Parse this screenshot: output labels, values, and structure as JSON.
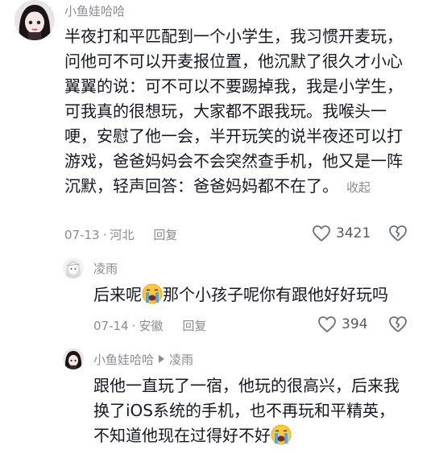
{
  "main_comment": {
    "username": "小鱼娃哈哈",
    "lines": [
      "半夜打和平匹配到一个小学生，我习惯开麦玩，",
      "问他可不可以开麦报位置，他沉默了很久才小心",
      "翼翼的说：可不可以不要踢掉我，我是小学生，",
      "可我真的很想玩，大家都不跟我玩。我喉头一",
      "哽，安慰了他一会，半开玩笑的说半夜还可以打",
      "游戏，爸爸妈妈会不会突然查手机，他又是一阵",
      "沉默，轻声回答：爸爸妈妈都不在了。"
    ],
    "collapse_label": "收起",
    "date": "07-13",
    "location": "河北",
    "reply_label": "回复",
    "like_count": "3421"
  },
  "reply1": {
    "username": "凌雨",
    "text_before": "后来呢",
    "emoji": "crying-face",
    "text_after": "那个小孩子呢你有跟他好好玩吗",
    "date": "07-14",
    "location": "安徽",
    "reply_label": "回复",
    "like_count": "394"
  },
  "reply2": {
    "username": "小鱼娃哈哈",
    "reply_to": "凌雨",
    "lines": [
      "跟他一直玩了一宿，他玩的很高兴，后来我",
      "换了iOS系统的手机，也不再玩和平精英，",
      "不知道他现在过得好不好"
    ],
    "emoji": "crying-face"
  },
  "icons": {
    "like": "heart-outline-icon",
    "dislike": "broken-heart-icon"
  }
}
